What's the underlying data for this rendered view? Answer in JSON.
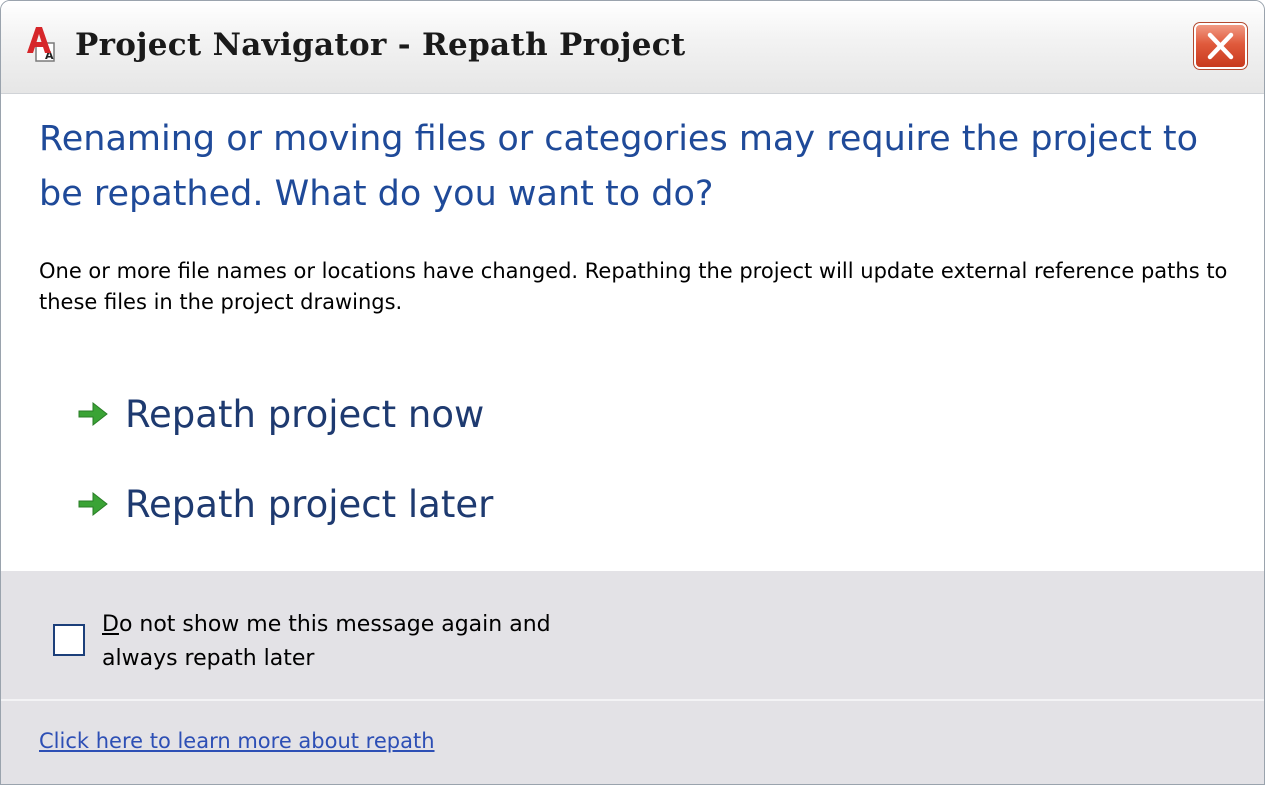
{
  "window": {
    "title": "Project Navigator - Repath Project",
    "icon": "autocad-icon",
    "close_icon": "close-icon"
  },
  "content": {
    "instruction": "Renaming or moving files or categories may require the project to be repathed. What do you want to do?",
    "description": "One or more file names or locations have changed. Repathing the project will update external reference paths to these files in the project drawings.",
    "commands": [
      {
        "label": "Repath project now",
        "icon": "green-arrow-icon"
      },
      {
        "label": "Repath project later",
        "icon": "green-arrow-icon"
      }
    ]
  },
  "footer": {
    "checkbox_checked": false,
    "checkbox_label_mnemonic": "D",
    "checkbox_label_rest": "o not show me this message again and",
    "checkbox_label_line2": "always repath later",
    "help_link": "Click here to learn more about repath"
  },
  "colors": {
    "instruction_text": "#1f4a99",
    "command_text": "#1e3a70",
    "arrow": "#3aa335",
    "link": "#2d4fb5",
    "footer_bg": "#e3e2e6",
    "close_button": "#e05a3c"
  }
}
